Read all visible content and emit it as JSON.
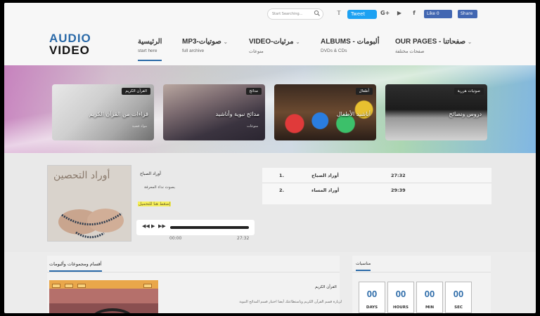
{
  "header": {
    "search_placeholder": "Start Searching...",
    "tweet_label": "Tweet",
    "fb_like_label": "Like 0",
    "fb_share_label": "Share",
    "social_icons": [
      "twitter-icon",
      "google-plus-icon",
      "youtube-icon",
      "facebook-icon"
    ]
  },
  "logo": {
    "line1": "AUDIO",
    "line2": "VIDEO"
  },
  "nav": [
    {
      "title": "الرئيسية",
      "sub": "start here"
    },
    {
      "title": "MP3-صوتيات",
      "sub": "full archive"
    },
    {
      "title": "VIDEO-مرئيات",
      "sub": "منوعات"
    },
    {
      "title": "ALBUMS - ألبومات",
      "sub": "DVDs & CDs"
    },
    {
      "title": "OUR PAGES - صفحاتنا",
      "sub": "صفحات مختلفة"
    }
  ],
  "cards": [
    {
      "badge": "القرآن الكريم",
      "title": "قراءات من القرآن الكريم",
      "sub": "مواد فضية"
    },
    {
      "badge": "مدائح",
      "title": "مدائح نبوية وأناشيد",
      "sub": "منوعات"
    },
    {
      "badge": "أطفال",
      "title": "أناشيد الأطفال",
      "sub": ""
    },
    {
      "badge": "صوتيات هررية",
      "title": "دروس ونصائح",
      "sub": ""
    }
  ],
  "player": {
    "cover_text": "أوراد التحصين",
    "title": "أوراد الصباح",
    "artist": "بصوت نداء المعرفة",
    "link_text": "إضغط هنا للتحميل",
    "time_current": "00:00",
    "time_total": "27:32",
    "playlist": [
      {
        "num": "1.",
        "name": "أوراد الصباح",
        "duration": "27:32"
      },
      {
        "num": "2.",
        "name": "أوراد المساء",
        "duration": "29:39"
      }
    ]
  },
  "sections": {
    "title": "أقسام ومجموعات وألبومات",
    "item_title": "القرآن الكريم",
    "item_desc": "لزيارة قسم القرآن الكريم وباستطاعتك أيضا اختيار قسم المدائح النبوية"
  },
  "occasions": {
    "title": "مناسبات",
    "countdown": [
      {
        "value": "00",
        "label": "DAYS"
      },
      {
        "value": "00",
        "label": "HOURS"
      },
      {
        "value": "00",
        "label": "MIN"
      },
      {
        "value": "00",
        "label": "SEC"
      }
    ]
  },
  "colors": {
    "accent": "#2b6aa8",
    "tweet": "#1da1f2",
    "facebook": "#4267b2"
  }
}
